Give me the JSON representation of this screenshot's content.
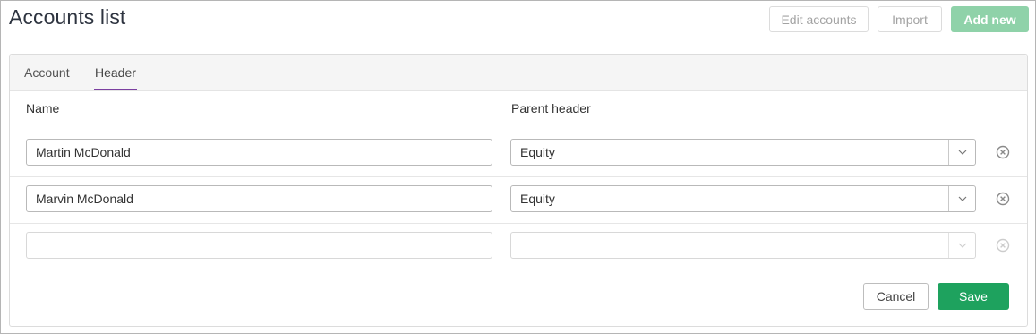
{
  "header": {
    "title": "Accounts list",
    "edit_accounts_label": "Edit accounts",
    "import_label": "Import",
    "add_new_label": "Add new"
  },
  "tabs": [
    {
      "label": "Account",
      "active": false
    },
    {
      "label": "Header",
      "active": true
    }
  ],
  "form": {
    "columns": {
      "name": "Name",
      "parent_header": "Parent header"
    },
    "rows": [
      {
        "name": "Martin McDonald",
        "parent_header": "Equity"
      },
      {
        "name": "Marvin McDonald",
        "parent_header": "Equity"
      },
      {
        "name": "",
        "parent_header": ""
      }
    ]
  },
  "footer": {
    "cancel_label": "Cancel",
    "save_label": "Save"
  },
  "colors": {
    "accent_purple": "#7b3fa0",
    "save_green": "#1ea25e",
    "add_new_green_disabled": "#8fd2a9"
  },
  "icons": {
    "remove": "close-circle-icon",
    "select": "chevron-down-icon"
  }
}
